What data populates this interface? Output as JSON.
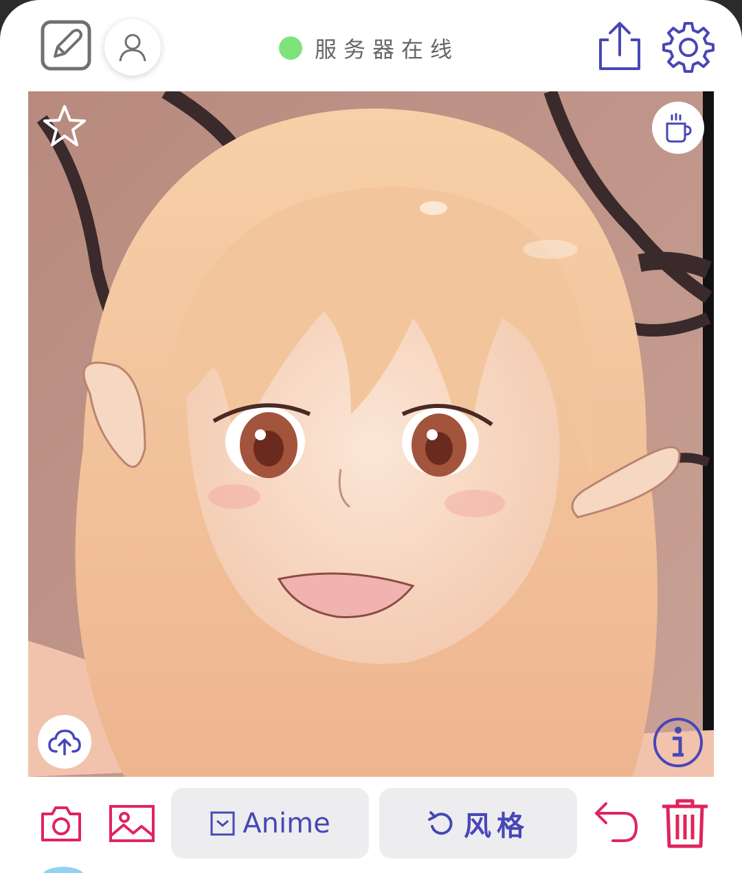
{
  "header": {
    "status_text": "服务器在线",
    "status_color": "#7ee37a",
    "icons": [
      "edit-icon",
      "user-icon",
      "share-icon",
      "gear-icon"
    ]
  },
  "canvas": {
    "icons": [
      "star-icon",
      "coffee-icon",
      "cloud-upload-icon",
      "info-icon"
    ]
  },
  "toolbar": {
    "model_label": "Anime",
    "style_label": "风格",
    "icons": [
      "camera-icon",
      "gallery-icon",
      "undo-icon",
      "trash-icon"
    ]
  },
  "colors": {
    "accent_blue": "#4747b8",
    "accent_red": "#e0245e",
    "gray": "#707070"
  }
}
